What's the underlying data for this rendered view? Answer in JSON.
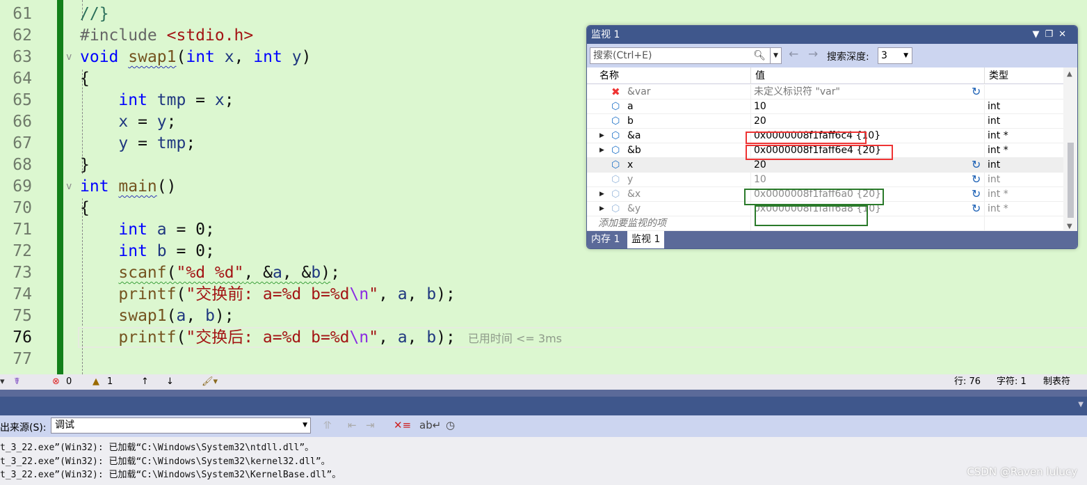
{
  "editor": {
    "current_line": "76",
    "lines": [
      {
        "n": "61",
        "t": [
          [
            "c",
            "//}"
          ]
        ]
      },
      {
        "n": "62",
        "t": [
          [
            "d",
            "#include "
          ],
          [
            "s",
            "<stdio.h>"
          ]
        ]
      },
      {
        "n": "63",
        "t": [
          [
            "k",
            "void "
          ],
          [
            "f sq",
            "swap1"
          ],
          [
            "o",
            "("
          ],
          [
            "k",
            "int "
          ],
          [
            "p",
            "x"
          ],
          [
            "o",
            ", "
          ],
          [
            "k",
            "int "
          ],
          [
            "p",
            "y"
          ],
          [
            "o",
            ")"
          ]
        ]
      },
      {
        "n": "64",
        "t": [
          [
            "o",
            "{"
          ]
        ]
      },
      {
        "n": "65",
        "t": [
          [
            "o",
            "    "
          ],
          [
            "k",
            "int "
          ],
          [
            "p",
            "tmp"
          ],
          [
            "o",
            " = "
          ],
          [
            "p",
            "x"
          ],
          [
            "o",
            ";"
          ]
        ]
      },
      {
        "n": "66",
        "t": [
          [
            "o",
            "    "
          ],
          [
            "p",
            "x"
          ],
          [
            "o",
            " = "
          ],
          [
            "p",
            "y"
          ],
          [
            "o",
            ";"
          ]
        ]
      },
      {
        "n": "67",
        "t": [
          [
            "o",
            "    "
          ],
          [
            "p",
            "y"
          ],
          [
            "o",
            " = "
          ],
          [
            "p",
            "tmp"
          ],
          [
            "o",
            ";"
          ]
        ]
      },
      {
        "n": "68",
        "t": [
          [
            "o",
            "}"
          ]
        ]
      },
      {
        "n": "69",
        "t": [
          [
            "k",
            "int "
          ],
          [
            "f sq",
            "main"
          ],
          [
            "o",
            "()"
          ]
        ]
      },
      {
        "n": "70",
        "t": [
          [
            "o",
            "{"
          ]
        ]
      },
      {
        "n": "71",
        "t": [
          [
            "o",
            "    "
          ],
          [
            "k",
            "int "
          ],
          [
            "p",
            "a"
          ],
          [
            "o",
            " = 0;"
          ]
        ]
      },
      {
        "n": "72",
        "t": [
          [
            "o",
            "    "
          ],
          [
            "k",
            "int "
          ],
          [
            "p",
            "b"
          ],
          [
            "o",
            " = 0;"
          ]
        ]
      },
      {
        "n": "73",
        "t": [
          [
            "o",
            "    "
          ],
          [
            "f sqg",
            "scanf"
          ],
          [
            "o sqg",
            "("
          ],
          [
            "s sqg",
            "\"%d %d\""
          ],
          [
            "o sqg",
            ", &"
          ],
          [
            "p sqg",
            "a"
          ],
          [
            "o sqg",
            ", &"
          ],
          [
            "p sqg",
            "b"
          ],
          [
            "o sqg",
            ")"
          ],
          [
            "o",
            ";"
          ]
        ]
      },
      {
        "n": "74",
        "t": [
          [
            "o",
            "    "
          ],
          [
            "f",
            "printf"
          ],
          [
            "o",
            "("
          ],
          [
            "s",
            "\"交换前: a=%d b=%d"
          ],
          [
            "e",
            "\\n"
          ],
          [
            "s",
            "\""
          ],
          [
            "o",
            ", "
          ],
          [
            "p",
            "a"
          ],
          [
            "o",
            ", "
          ],
          [
            "p",
            "b"
          ],
          [
            "o",
            ");"
          ]
        ]
      },
      {
        "n": "75",
        "t": [
          [
            "o",
            "    "
          ],
          [
            "f",
            "swap1"
          ],
          [
            "o",
            "("
          ],
          [
            "p",
            "a"
          ],
          [
            "o",
            ", "
          ],
          [
            "p",
            "b"
          ],
          [
            "o",
            ");"
          ]
        ]
      },
      {
        "n": "76",
        "t": [
          [
            "o",
            "    "
          ],
          [
            "f",
            "printf"
          ],
          [
            "o",
            "("
          ],
          [
            "s",
            "\"交换后: a=%d b=%d"
          ],
          [
            "e",
            "\\n"
          ],
          [
            "s",
            "\""
          ],
          [
            "o",
            ", "
          ],
          [
            "p",
            "a"
          ],
          [
            "o",
            ", "
          ],
          [
            "p",
            "b"
          ],
          [
            "o",
            ");"
          ]
        ]
      },
      {
        "n": "77",
        "t": []
      }
    ],
    "perf_tip": "已用时间 <= 3ms"
  },
  "watch": {
    "title": "监视 1",
    "search_placeholder": "搜索(Ctrl+E)",
    "depth_label": "搜索深度:",
    "depth_value": "3",
    "columns": {
      "name": "名称",
      "value": "值",
      "type": "类型"
    },
    "rows": [
      {
        "name": "&var",
        "value": "未定义标识符 \"var\"",
        "type": "",
        "kind": "err",
        "expand": false,
        "refresh": true
      },
      {
        "name": "a",
        "value": "10",
        "type": "int",
        "kind": "normal",
        "expand": false,
        "refresh": false
      },
      {
        "name": "b",
        "value": "20",
        "type": "int",
        "kind": "normal",
        "expand": false,
        "refresh": false
      },
      {
        "name": "&a",
        "value": "0x0000008f1faff6c4 {10}",
        "type": "int *",
        "kind": "normal",
        "expand": true,
        "refresh": false
      },
      {
        "name": "&b",
        "value": "0x0000008f1faff6e4 {20}",
        "type": "int *",
        "kind": "normal",
        "expand": true,
        "refresh": false
      },
      {
        "name": "x",
        "value": "20",
        "type": "int",
        "kind": "sel",
        "expand": false,
        "refresh": true
      },
      {
        "name": "y",
        "value": "10",
        "type": "int",
        "kind": "dim",
        "expand": false,
        "refresh": true
      },
      {
        "name": "&x",
        "value": "0x0000008f1faff6a0 {20}",
        "type": "int *",
        "kind": "dim",
        "expand": true,
        "refresh": true
      },
      {
        "name": "&y",
        "value": "0x0000008f1faff6a8 {10}",
        "type": "int *",
        "kind": "dim",
        "expand": true,
        "refresh": true
      }
    ],
    "add_item": "添加要监视的项",
    "tabs": [
      "内存 1",
      "监视 1"
    ],
    "annotation_colors": {
      "red": "#ee3333",
      "green": "#2a7a2a"
    }
  },
  "status": {
    "errors": "0",
    "warnings": "1",
    "line": "行: 76",
    "char": "字符: 1",
    "tab": "制表符"
  },
  "output": {
    "source_label": "出来源(S):",
    "source_value": "调试",
    "lines": [
      "t_3_22.exe”(Win32): 已加载“C:\\Windows\\System32\\ntdll.dll”。",
      "t_3_22.exe”(Win32): 已加载“C:\\Windows\\System32\\kernel32.dll”。",
      "t_3_22.exe”(Win32): 已加载“C:\\Windows\\System32\\KernelBase.dll”。"
    ]
  },
  "watermark": "CSDN @Raven lulucy"
}
